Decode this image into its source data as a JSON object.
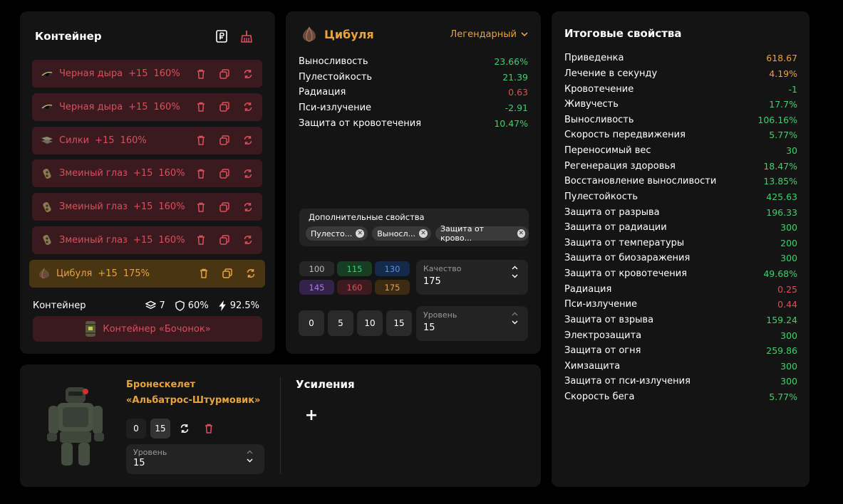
{
  "colors": {
    "green": "#3ecf6e",
    "red": "#d9505a",
    "orange": "#e8a33c",
    "white": "#ffffff"
  },
  "container": {
    "title": "Контейнер",
    "artifacts": [
      {
        "icon": "black-hole-icon",
        "name": "Черная дыра",
        "level": "+15",
        "percent": "160%",
        "selected": false
      },
      {
        "icon": "black-hole-icon",
        "name": "Черная дыра",
        "level": "+15",
        "percent": "160%",
        "selected": false
      },
      {
        "icon": "silk-icon",
        "name": "Силки",
        "level": "+15",
        "percent": "160%",
        "selected": false
      },
      {
        "icon": "snake-eye-icon",
        "name": "Змеиный глаз",
        "level": "+15",
        "percent": "160%",
        "selected": false
      },
      {
        "icon": "snake-eye-icon",
        "name": "Змеиный глаз",
        "level": "+15",
        "percent": "160%",
        "selected": false
      },
      {
        "icon": "snake-eye-icon",
        "name": "Змеиный глаз",
        "level": "+15",
        "percent": "160%",
        "selected": false
      },
      {
        "icon": "onion-icon",
        "name": "Цибуля",
        "level": "+15",
        "percent": "175%",
        "selected": true
      }
    ],
    "stats_label": "Контейнер",
    "stats": {
      "slots": "7",
      "protection": "60%",
      "efficiency": "92.5%"
    },
    "container_button": "Контейнер «Бочонок»"
  },
  "item": {
    "name": "Цибуля",
    "rarity": "Легендарный",
    "props": [
      {
        "name": "Выносливость",
        "value": "23.66%",
        "color": "#3ecf6e"
      },
      {
        "name": "Пулестойкость",
        "value": "21.39",
        "color": "#3ecf6e"
      },
      {
        "name": "Радиация",
        "value": "0.63",
        "color": "#d9505a"
      },
      {
        "name": "Пси-излучение",
        "value": "-2.91",
        "color": "#3ecf6e"
      },
      {
        "name": "Защита от кровотечения",
        "value": "10.47%",
        "color": "#3ecf6e"
      }
    ],
    "extra_label": "Дополнительные свойства",
    "extra_chips": [
      "Пулесто...",
      "Выносл...",
      "Защита от крово..."
    ],
    "quality_presets": [
      {
        "label": "100",
        "bg": "#262626",
        "fg": "#bdbdbd"
      },
      {
        "label": "115",
        "bg": "#173d24",
        "fg": "#3ecf6e"
      },
      {
        "label": "130",
        "bg": "#15294a",
        "fg": "#5b8fe0"
      },
      {
        "label": "145",
        "bg": "#34224a",
        "fg": "#a37de0"
      },
      {
        "label": "160",
        "bg": "#3d1a1f",
        "fg": "#d9505a"
      },
      {
        "label": "175",
        "bg": "#3d2a12",
        "fg": "#e8a33c"
      }
    ],
    "quality_label": "Качество",
    "quality_value": "175",
    "level_presets": [
      "0",
      "5",
      "10",
      "15"
    ],
    "level_label": "Уровень",
    "level_value": "15"
  },
  "summary": {
    "title": "Итоговые свойства",
    "rows": [
      {
        "name": "Приведенка",
        "value": "618.67",
        "color": "#e8a33c"
      },
      {
        "name": "Лечение в секунду",
        "value": "4.19%",
        "color": "#e8a33c"
      },
      {
        "name": "Кровотечение",
        "value": "-1",
        "color": "#3ecf6e"
      },
      {
        "name": "Живучесть",
        "value": "17.7%",
        "color": "#3ecf6e"
      },
      {
        "name": "Выносливость",
        "value": "106.16%",
        "color": "#3ecf6e"
      },
      {
        "name": "Скорость передвижения",
        "value": "5.77%",
        "color": "#3ecf6e"
      },
      {
        "name": "Переносимый вес",
        "value": "30",
        "color": "#3ecf6e"
      },
      {
        "name": "Регенерация здоровья",
        "value": "18.47%",
        "color": "#3ecf6e"
      },
      {
        "name": "Восстановление выносливости",
        "value": "13.85%",
        "color": "#3ecf6e"
      },
      {
        "name": "Пулестойкость",
        "value": "425.63",
        "color": "#3ecf6e"
      },
      {
        "name": "Защита от разрыва",
        "value": "196.33",
        "color": "#3ecf6e"
      },
      {
        "name": "Защита от радиации",
        "value": "300",
        "color": "#3ecf6e"
      },
      {
        "name": "Защита от температуры",
        "value": "200",
        "color": "#3ecf6e"
      },
      {
        "name": "Защита от биозаражения",
        "value": "300",
        "color": "#3ecf6e"
      },
      {
        "name": "Защита от кровотечения",
        "value": "49.68%",
        "color": "#3ecf6e"
      },
      {
        "name": "Радиация",
        "value": "0.25",
        "color": "#d9505a"
      },
      {
        "name": "Пси-излучение",
        "value": "0.44",
        "color": "#d9505a"
      },
      {
        "name": "Защита от взрыва",
        "value": "159.24",
        "color": "#3ecf6e"
      },
      {
        "name": "Электрозащита",
        "value": "300",
        "color": "#3ecf6e"
      },
      {
        "name": "Защита от огня",
        "value": "259.86",
        "color": "#3ecf6e"
      },
      {
        "name": "Химзащита",
        "value": "300",
        "color": "#3ecf6e"
      },
      {
        "name": "Защита от пси-излучения",
        "value": "300",
        "color": "#3ecf6e"
      },
      {
        "name": "Скорость бега",
        "value": "5.77%",
        "color": "#3ecf6e"
      }
    ]
  },
  "armor": {
    "title_line1": "Бронескелет",
    "title_line2": "«Альбатрос-Штурмовик»",
    "level_min": "0",
    "level_current": "15",
    "level_label": "Уровень",
    "level_value": "15",
    "upgrades_title": "Усиления",
    "add_symbol": "+"
  }
}
